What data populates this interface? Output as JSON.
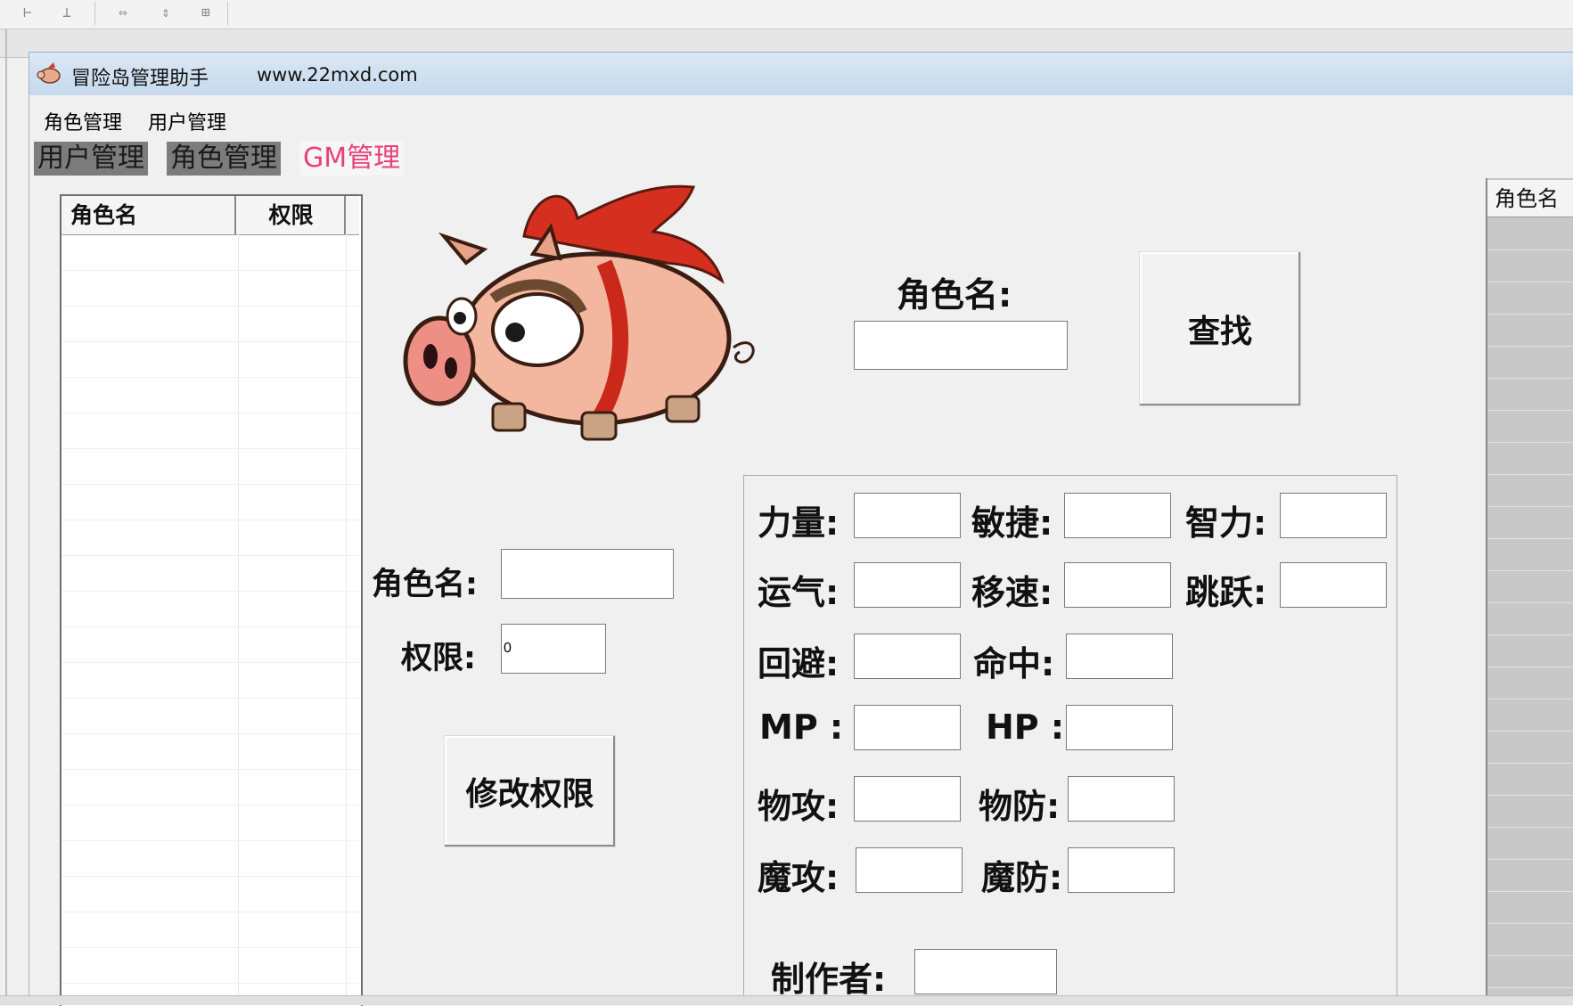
{
  "window": {
    "title": "冒险岛管理助手",
    "url": "www.22mxd.com"
  },
  "menu": {
    "items": [
      {
        "label": "角色管理"
      },
      {
        "label": "用户管理"
      }
    ]
  },
  "tabs": [
    {
      "label": "用户管理",
      "active": false
    },
    {
      "label": "角色管理",
      "active": false
    },
    {
      "label": "GM管理",
      "active": true
    }
  ],
  "left_list": {
    "columns": [
      "角色名",
      "权限"
    ]
  },
  "search": {
    "label": "角色名:",
    "value": "",
    "button": "查找"
  },
  "permission": {
    "name_label": "角色名:",
    "name_value": "",
    "level_label": "权限:",
    "level_value": "0",
    "button": "修改权限"
  },
  "stats": {
    "str": {
      "label": "力量:",
      "value": ""
    },
    "dex": {
      "label": "敏捷:",
      "value": ""
    },
    "int": {
      "label": "智力:",
      "value": ""
    },
    "luk": {
      "label": "运气:",
      "value": ""
    },
    "speed": {
      "label": "移速:",
      "value": ""
    },
    "jump": {
      "label": "跳跃:",
      "value": ""
    },
    "avoid": {
      "label": "回避:",
      "value": ""
    },
    "hit": {
      "label": "命中:",
      "value": ""
    },
    "mp": {
      "label": "MP :",
      "value": ""
    },
    "hp": {
      "label": "HP :",
      "value": ""
    },
    "watk": {
      "label": "物攻:",
      "value": ""
    },
    "wdef": {
      "label": "物防:",
      "value": ""
    },
    "matk": {
      "label": "魔攻:",
      "value": ""
    },
    "mdef": {
      "label": "魔防:",
      "value": ""
    },
    "maker": {
      "label": "制作者:",
      "value": ""
    }
  },
  "right_list": {
    "column": "角色名"
  },
  "colors": {
    "active_tab": "#e8407a",
    "titlebar": "#c6d9ee",
    "inactive_tab": "#7c7c7c"
  }
}
